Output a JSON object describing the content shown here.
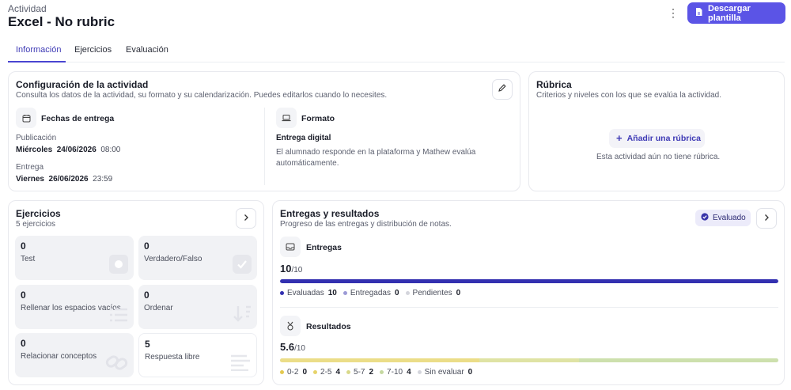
{
  "header": {
    "kicker": "Actividad",
    "title": "Excel - No rubric",
    "download_label": "Descargar plantilla"
  },
  "tabs": [
    {
      "label": "Información",
      "active": true
    },
    {
      "label": "Ejercicios",
      "active": false
    },
    {
      "label": "Evaluación",
      "active": false
    }
  ],
  "config": {
    "title": "Configuración de la actividad",
    "subtitle": "Consulta los datos de la actividad, su formato y su calendarización. Puedes editarlos cuando lo necesites.",
    "dates": {
      "heading": "Fechas de entrega",
      "publication_label": "Publicación",
      "publication_day": "Miércoles",
      "publication_date": "24/06/2026",
      "publication_time": "08:00",
      "delivery_label": "Entrega",
      "delivery_day": "Viernes",
      "delivery_date": "26/06/2026",
      "delivery_time": "23:59"
    },
    "format": {
      "heading": "Formato",
      "type": "Entrega digital",
      "description_line1": "El alumnado responde en la plataforma y Mathew evalúa",
      "description_line2": "automáticamente."
    }
  },
  "rubric": {
    "title": "Rúbrica",
    "subtitle": "Criterios y niveles con los que se evalúa la actividad.",
    "add_label": "Añadir una rúbrica",
    "empty_text": "Esta actividad aún no tiene rúbrica."
  },
  "exercises": {
    "title": "Ejercicios",
    "count_text": "5 ejercicios",
    "tiles": [
      {
        "count": "0",
        "label": "Test",
        "icon": "circle-icon"
      },
      {
        "count": "0",
        "label": "Verdadero/Falso",
        "icon": "check-icon"
      },
      {
        "count": "0",
        "label": "Rellenar los espacios vacíos",
        "icon": "list-icon"
      },
      {
        "count": "0",
        "label": "Ordenar",
        "icon": "sort-icon"
      },
      {
        "count": "0",
        "label": "Relacionar conceptos",
        "icon": "link-icon"
      },
      {
        "count": "5",
        "label": "Respuesta libre",
        "icon": "text-lines-icon"
      }
    ]
  },
  "results": {
    "title": "Entregas y resultados",
    "subtitle": "Progreso de las entregas y distribución de notas.",
    "status_badge": "Evaluado",
    "submissions": {
      "heading": "Entregas",
      "value": "10",
      "total": "/10",
      "fill_fraction": 1.0,
      "legend": [
        {
          "label": "Evaluadas",
          "count": "10",
          "color": "#3330b0"
        },
        {
          "label": "Entregadas",
          "count": "0",
          "color": "#9c9ad6"
        },
        {
          "label": "Pendientes",
          "count": "0",
          "color": "#d4d5dc"
        }
      ]
    },
    "grades": {
      "heading": "Resultados",
      "value": "5.6",
      "total": "/10",
      "segments": [
        {
          "range": "0-2",
          "count": 0,
          "color": "#e6d36a"
        },
        {
          "range": "2-5",
          "count": 4,
          "color": "#ebdd88"
        },
        {
          "range": "5-7",
          "count": 2,
          "color": "#dfe3a4"
        },
        {
          "range": "7-10",
          "count": 4,
          "color": "#cde0ad"
        }
      ],
      "legend": [
        {
          "label": "0-2",
          "count": "0",
          "color": "#e3c94f"
        },
        {
          "label": "2-5",
          "count": "4",
          "color": "#e6d36a"
        },
        {
          "label": "5-7",
          "count": "2",
          "color": "#d9d98a"
        },
        {
          "label": "7-10",
          "count": "4",
          "color": "#c5d8a0"
        },
        {
          "label": "Sin evaluar",
          "count": "0",
          "color": "#d4d5dc"
        }
      ]
    }
  }
}
